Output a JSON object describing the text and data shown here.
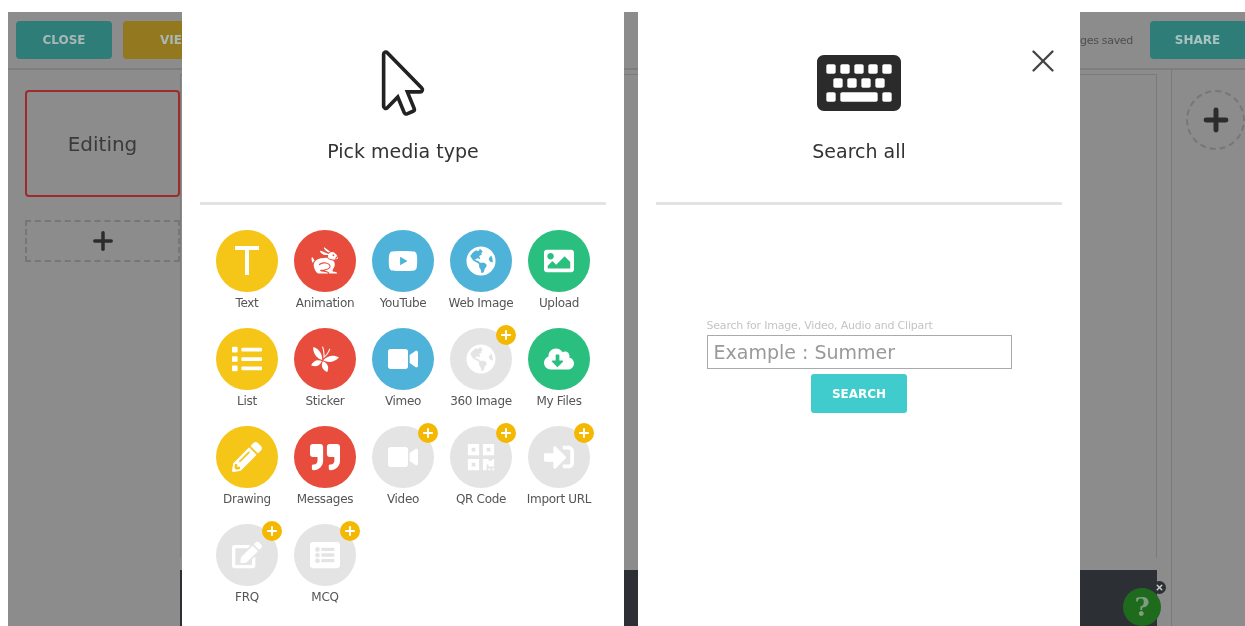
{
  "app": {
    "close_button": "CLOSE",
    "view_button": "VIE",
    "status": "ges saved",
    "share_button": "SHARE",
    "slides": [
      {
        "label": "Editing",
        "selected": true
      }
    ]
  },
  "media_panel": {
    "title": "Pick media type",
    "items": [
      {
        "label": "Text",
        "locked": false,
        "color": "#f5c518"
      },
      {
        "label": "Animation",
        "locked": false,
        "color": "#e74c3c"
      },
      {
        "label": "YouTube",
        "locked": false,
        "color": "#4fb3d9"
      },
      {
        "label": "Web Image",
        "locked": false,
        "color": "#4fb3d9"
      },
      {
        "label": "Upload",
        "locked": false,
        "color": "#2bbf7f"
      },
      {
        "label": "List",
        "locked": false,
        "color": "#f5c518"
      },
      {
        "label": "Sticker",
        "locked": false,
        "color": "#e74c3c"
      },
      {
        "label": "Vimeo",
        "locked": false,
        "color": "#4fb3d9"
      },
      {
        "label": "360 Image",
        "locked": true
      },
      {
        "label": "My Files",
        "locked": false,
        "color": "#2bbf7f"
      },
      {
        "label": "Drawing",
        "locked": false,
        "color": "#f5c518"
      },
      {
        "label": "Messages",
        "locked": false,
        "color": "#e74c3c"
      },
      {
        "label": "Video",
        "locked": true
      },
      {
        "label": "QR Code",
        "locked": true
      },
      {
        "label": "Import URL",
        "locked": true
      },
      {
        "label": "FRQ",
        "locked": true
      },
      {
        "label": "MCQ",
        "locked": true
      }
    ]
  },
  "search_panel": {
    "title": "Search all",
    "hint": "Search for Image, Video, Audio and Clipart",
    "placeholder": "Example : Summer",
    "button": "SEARCH"
  },
  "help": {
    "label": "?"
  }
}
